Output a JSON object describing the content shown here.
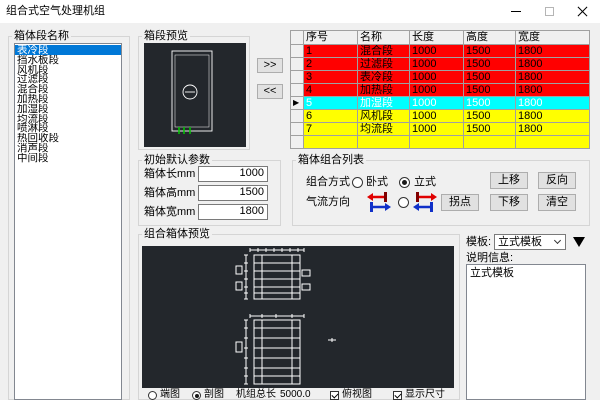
{
  "window": {
    "title": "组合式空气处理机组",
    "minimize_icon": "minimize-icon",
    "maximize_icon": "maximize-icon",
    "close_icon": "close-icon"
  },
  "section_list": {
    "title": "箱体段名称",
    "selected": 0,
    "items": [
      "表冷段",
      "挡水板段",
      "风机段",
      "过滤段",
      "混合段",
      "加热段",
      "加湿段",
      "均流段",
      "喷淋段",
      "热回收段",
      "消声段",
      "中间段"
    ]
  },
  "section_preview": {
    "title": "箱段预览"
  },
  "transfer": {
    "add_label": ">>",
    "remove_label": "<<"
  },
  "grid": {
    "columns": [
      "序号",
      "名称",
      "长度",
      "高度",
      "宽度"
    ],
    "current_row": 4,
    "current_row_marker": "▶",
    "rows": [
      {
        "no": "1",
        "name": "混合段",
        "length": "1000",
        "height": "1500",
        "width": "1800",
        "bg": "#ff0000",
        "fg": "#000000"
      },
      {
        "no": "2",
        "name": "过滤段",
        "length": "1000",
        "height": "1500",
        "width": "1800",
        "bg": "#ff0000",
        "fg": "#000000"
      },
      {
        "no": "3",
        "name": "表冷段",
        "length": "1000",
        "height": "1500",
        "width": "1800",
        "bg": "#ff0000",
        "fg": "#000000"
      },
      {
        "no": "4",
        "name": "加热段",
        "length": "1000",
        "height": "1500",
        "width": "1800",
        "bg": "#ff0000",
        "fg": "#000000"
      },
      {
        "no": "5",
        "name": "加湿段",
        "length": "1000",
        "height": "1500",
        "width": "1800",
        "bg": "#00ffff",
        "fg": "#ffffff"
      },
      {
        "no": "6",
        "name": "风机段",
        "length": "1000",
        "height": "1500",
        "width": "1800",
        "bg": "#ffff00",
        "fg": "#000000"
      },
      {
        "no": "7",
        "name": "均流段",
        "length": "1000",
        "height": "1500",
        "width": "1800",
        "bg": "#ffff00",
        "fg": "#000000"
      },
      {
        "no": "",
        "name": "",
        "length": "",
        "height": "",
        "width": "",
        "bg": "#ffff00",
        "fg": "#000000"
      }
    ]
  },
  "defaults": {
    "title": "初始默认参数",
    "length_label": "箱体长mm",
    "length": "1000",
    "height_label": "箱体高mm",
    "height": "1500",
    "width_label": "箱体宽mm",
    "width": "1800"
  },
  "combo_list": {
    "title": "箱体组合列表",
    "mode_label": "组合方式",
    "mode_horizontal": "卧式",
    "mode_horizontal_checked": false,
    "mode_vertical": "立式",
    "mode_vertical_checked": true,
    "direction_label": "气流方向",
    "direction_icons": [
      "airflow-left-right-icon",
      "airflow-right-left-icon"
    ],
    "direction_second_checked": false,
    "buttons": {
      "up": "上移",
      "reverse": "反向",
      "turn": "拐点",
      "down": "下移",
      "clear": "清空"
    }
  },
  "assembly_preview": {
    "title": "组合箱体预览",
    "end_view": "端图",
    "end_view_checked": false,
    "section_view": "剖图",
    "section_view_checked": true,
    "total_length_label": "机组总长",
    "total_length": "5000.0",
    "top_view": "俯视图",
    "top_view_checked": true,
    "show_dims": "显示尺寸",
    "show_dims_checked": true
  },
  "template": {
    "label": "模板:",
    "value": "立式模板",
    "info_label": "说明信息:",
    "info_text": "立式模板"
  },
  "colors": {
    "selection": "#0078d7",
    "canvas": "#23272c",
    "drawing_stroke": "#ffffff",
    "mark_green": "#00c800",
    "arrow_red": "#e00000",
    "arrow_dark_red": "#800000",
    "arrow_blue": "#1030c8"
  }
}
